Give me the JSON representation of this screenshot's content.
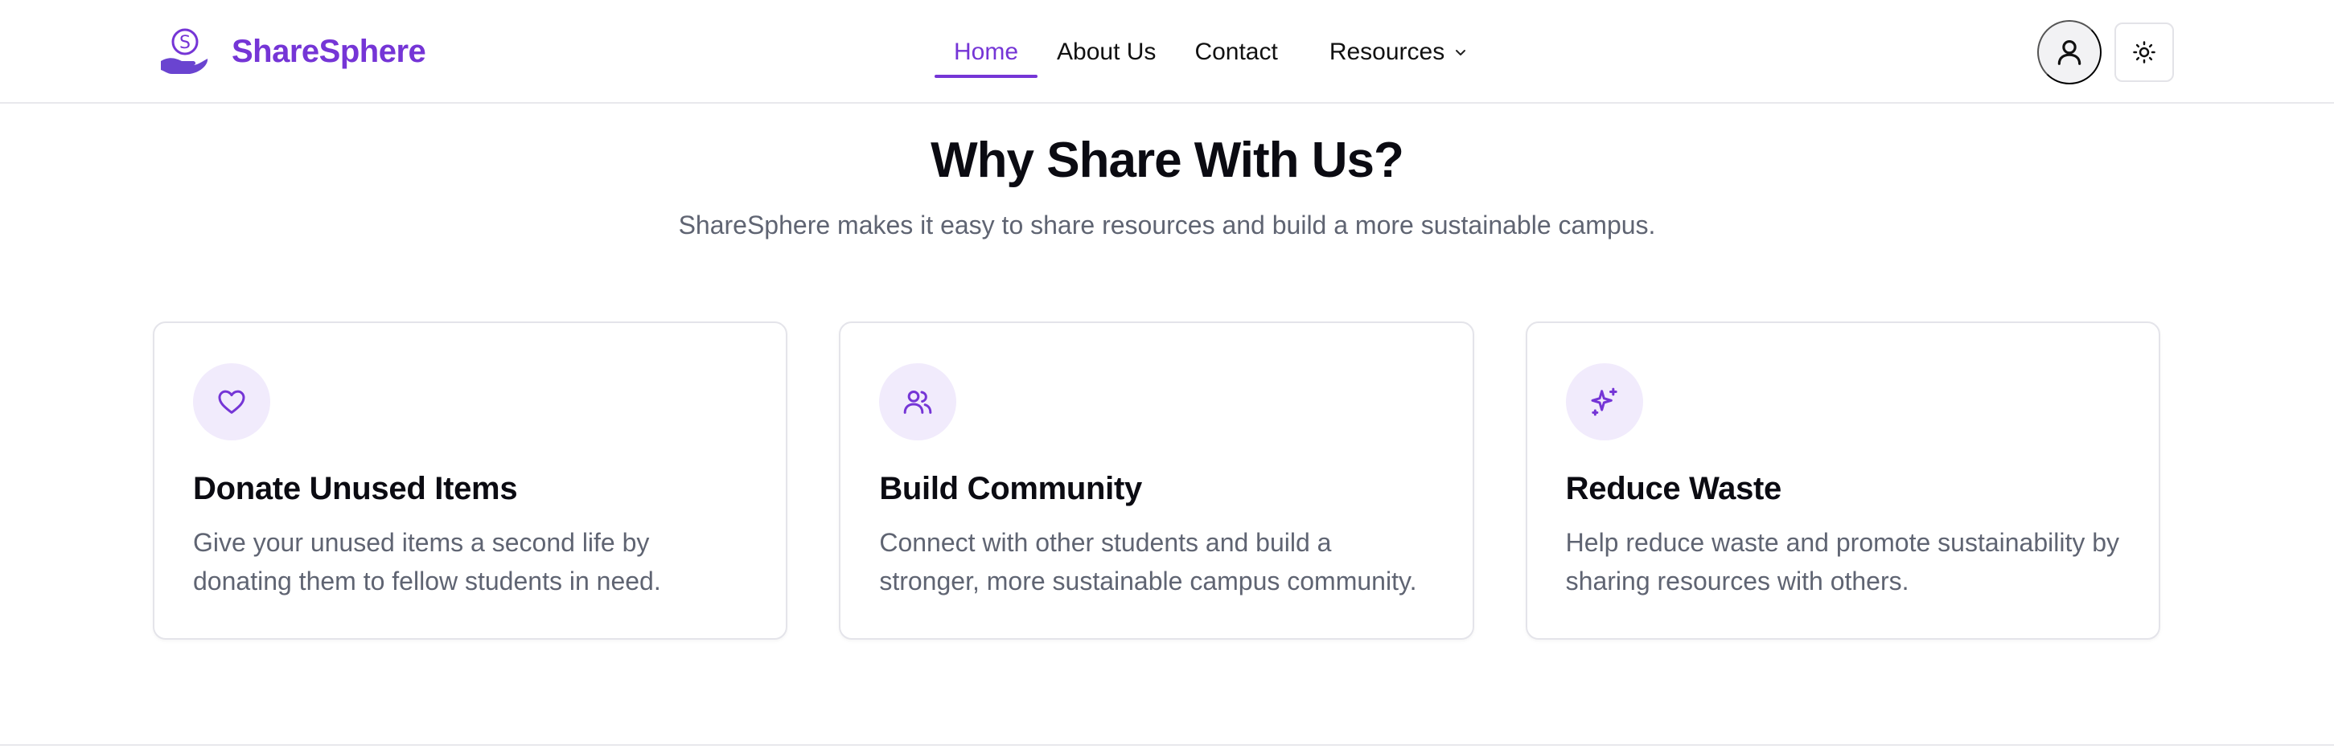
{
  "brand": {
    "name": "ShareSphere",
    "logo_icon": "hand-coin-icon",
    "accent_color": "#7535d6"
  },
  "nav": {
    "items": [
      {
        "label": "Home",
        "active": true
      },
      {
        "label": "About Us",
        "active": false
      },
      {
        "label": "Contact",
        "active": false
      },
      {
        "label": "Resources",
        "active": false,
        "icon": "chevron-down-icon"
      }
    ]
  },
  "header_actions": {
    "user_icon": "user-icon",
    "theme_icon": "sun-icon"
  },
  "section": {
    "title": "Why Share With Us?",
    "subtitle": "ShareSphere makes it easy to share resources and build a more sustainable campus."
  },
  "cards": [
    {
      "icon": "heart-icon",
      "title": "Donate Unused Items",
      "description": "Give your unused items a second life by donating them to fellow students in need."
    },
    {
      "icon": "users-icon",
      "title": "Build Community",
      "description": "Connect with other students and build a stronger, more sustainable campus community."
    },
    {
      "icon": "sparkles-icon",
      "title": "Reduce Waste",
      "description": "Help reduce waste and promote sustainability by sharing resources with others."
    }
  ]
}
